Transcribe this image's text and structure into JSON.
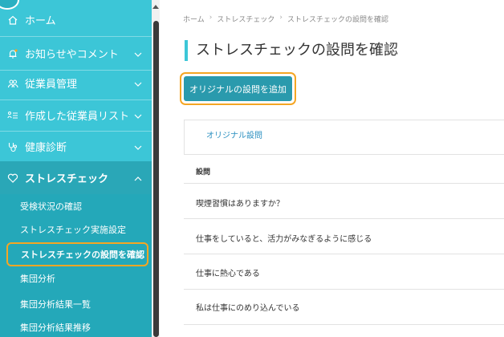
{
  "sidebar": {
    "items": [
      {
        "label": "ホーム",
        "icon": "home-icon"
      },
      {
        "label": "お知らせやコメント",
        "icon": "bell-icon"
      },
      {
        "label": "従業員管理",
        "icon": "people-icon"
      },
      {
        "label": "作成した従業員リスト",
        "icon": "list-icon"
      },
      {
        "label": "健康診断",
        "icon": "stethoscope-icon"
      },
      {
        "label": "ストレスチェック",
        "icon": "heart-icon"
      }
    ],
    "subitems": [
      {
        "label": "受検状況の確認"
      },
      {
        "label": "ストレスチェック実施設定"
      },
      {
        "label": "ストレスチェックの設問を確認"
      },
      {
        "label": "集団分析"
      },
      {
        "label": "集団分析結果一覧"
      },
      {
        "label": "集団分析結果推移"
      }
    ]
  },
  "breadcrumb": [
    "ホーム",
    "ストレスチェック",
    "ストレスチェックの設問を確認"
  ],
  "page_title": "ストレスチェックの設問を確認",
  "add_button_label": "オリジナルの設問を追加",
  "tab_label": "オリジナル設問",
  "table": {
    "header": "設問",
    "rows": [
      "喫煙習慣はありますか？",
      "仕事をしていると、活力がみなぎるように感じる",
      "仕事に熱心である",
      "私は仕事にのめり込んでいる"
    ]
  },
  "colors": {
    "sidebar_bg": "#3cc6d7",
    "active_bg": "#2aa7b7",
    "submenu_bg": "#24a8b9",
    "button_bg": "#2a9aad",
    "highlight": "#f5a623"
  }
}
